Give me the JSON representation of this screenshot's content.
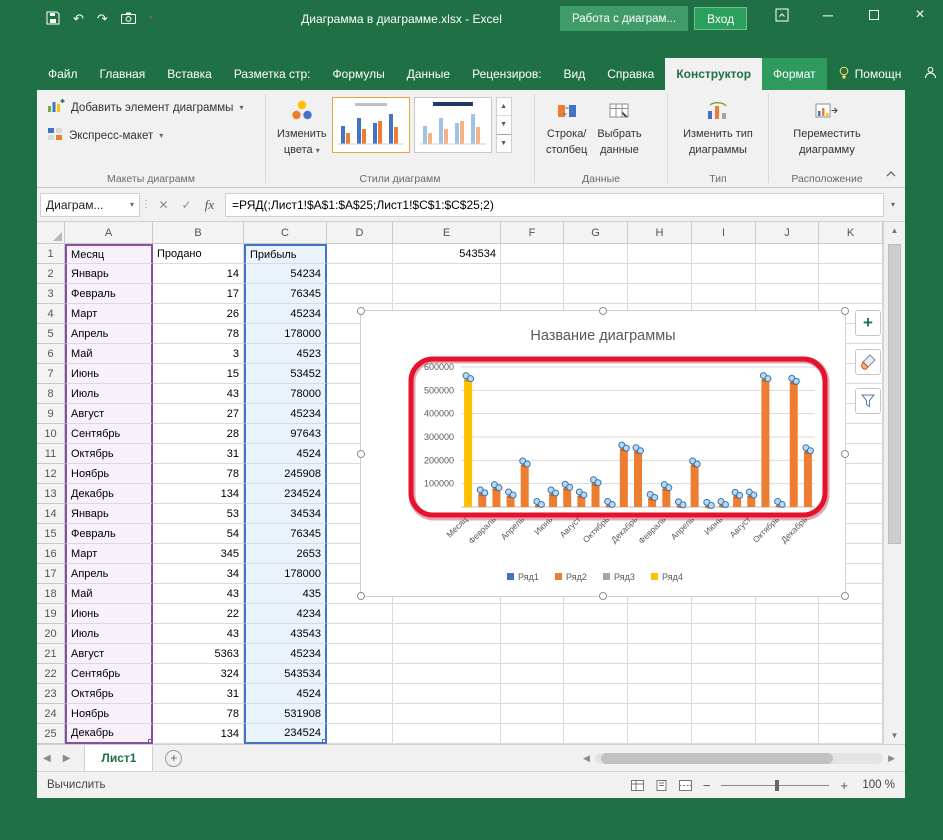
{
  "window": {
    "title": "Диаграмма в диаграмме.xlsx  -  Excel",
    "context_group": "Работа с диаграм...",
    "sign_in": "Вход"
  },
  "tabs": {
    "items": [
      {
        "id": "file",
        "label": "Файл"
      },
      {
        "id": "home",
        "label": "Главная"
      },
      {
        "id": "insert",
        "label": "Вставка"
      },
      {
        "id": "page-layout",
        "label": "Разметка стр:"
      },
      {
        "id": "formulas",
        "label": "Формулы"
      },
      {
        "id": "data",
        "label": "Данные"
      },
      {
        "id": "review",
        "label": "Рецензиров:"
      },
      {
        "id": "view",
        "label": "Вид"
      },
      {
        "id": "help",
        "label": "Справка"
      },
      {
        "id": "design",
        "label": "Конструктор"
      },
      {
        "id": "format",
        "label": "Формат"
      }
    ],
    "active_id": "design",
    "assistant": "Помощн",
    "share": "Поделиться"
  },
  "ribbon": {
    "add_element": "Добавить элемент диаграммы",
    "quick_layout": "Экспресс-макет",
    "change_colors": [
      "Изменить",
      "цвета"
    ],
    "row_col": [
      "Строка/",
      "столбец"
    ],
    "select_data": [
      "Выбрать",
      "данные"
    ],
    "change_type": [
      "Изменить тип",
      "диаграммы"
    ],
    "move_chart": [
      "Переместить",
      "диаграмму"
    ],
    "groups": {
      "layouts": "Макеты диаграмм",
      "styles": "Стили диаграмм",
      "data": "Данные",
      "type": "Тип",
      "location": "Расположение"
    }
  },
  "formula_bar": {
    "name_box": "Диаграм...",
    "fx": "fx",
    "formula": "=РЯД(;Лист1!$A$1:$A$25;Лист1!$C$1:$C$25;2)"
  },
  "grid": {
    "col_headers": [
      "A",
      "B",
      "C",
      "D",
      "E",
      "F",
      "G",
      "H",
      "I",
      "J",
      "K"
    ],
    "rows": [
      {
        "n": "1",
        "A": "Месяц",
        "B": "Продано",
        "C": "Прибыль",
        "E": "543534"
      },
      {
        "n": "2",
        "A": "Январь",
        "B": "14",
        "C": "54234"
      },
      {
        "n": "3",
        "A": "Февраль",
        "B": "17",
        "C": "76345"
      },
      {
        "n": "4",
        "A": "Март",
        "B": "26",
        "C": "45234"
      },
      {
        "n": "5",
        "A": "Апрель",
        "B": "78",
        "C": "178000"
      },
      {
        "n": "6",
        "A": "Май",
        "B": "3",
        "C": "4523"
      },
      {
        "n": "7",
        "A": "Июнь",
        "B": "15",
        "C": "53452"
      },
      {
        "n": "8",
        "A": "Июль",
        "B": "43",
        "C": "78000"
      },
      {
        "n": "9",
        "A": "Август",
        "B": "27",
        "C": "45234"
      },
      {
        "n": "10",
        "A": "Сентябрь",
        "B": "28",
        "C": "97643"
      },
      {
        "n": "11",
        "A": "Октябрь",
        "B": "31",
        "C": "4524"
      },
      {
        "n": "12",
        "A": "Ноябрь",
        "B": "78",
        "C": "245908"
      },
      {
        "n": "13",
        "A": "Декабрь",
        "B": "134",
        "C": "234524"
      },
      {
        "n": "14",
        "A": "Январь",
        "B": "53",
        "C": "34534"
      },
      {
        "n": "15",
        "A": "Февраль",
        "B": "54",
        "C": "76345"
      },
      {
        "n": "16",
        "A": "Март",
        "B": "345",
        "C": "2653"
      },
      {
        "n": "17",
        "A": "Апрель",
        "B": "34",
        "C": "178000"
      },
      {
        "n": "18",
        "A": "Май",
        "B": "43",
        "C": "435"
      },
      {
        "n": "19",
        "A": "Июнь",
        "B": "22",
        "C": "4234"
      },
      {
        "n": "20",
        "A": "Июль",
        "B": "43",
        "C": "43543"
      },
      {
        "n": "21",
        "A": "Август",
        "B": "5363",
        "C": "45234"
      },
      {
        "n": "22",
        "A": "Сентябрь",
        "B": "324",
        "C": "543534"
      },
      {
        "n": "23",
        "A": "Октябрь",
        "B": "31",
        "C": "4524"
      },
      {
        "n": "24",
        "A": "Ноябрь",
        "B": "78",
        "C": "531908"
      },
      {
        "n": "25",
        "A": "Декабрь",
        "B": "134",
        "C": "234524"
      }
    ]
  },
  "chart_data": {
    "type": "bar",
    "title": "Название диаграммы",
    "categories": [
      "Месяц",
      "Январь",
      "Февраль",
      "Март",
      "Апрель",
      "Май",
      "Июнь",
      "Июль",
      "Август",
      "Сентябрь",
      "Октябрь",
      "Ноябрь",
      "Декабрь",
      "Январь",
      "Февраль",
      "Март",
      "Апрель",
      "Май",
      "Июнь",
      "Июль",
      "Август",
      "Сентябрь",
      "Октябрь",
      "Ноябрь",
      "Декабрь"
    ],
    "x_tick_step": 2,
    "ylim": [
      0,
      600000
    ],
    "yticks": [
      100000,
      200000,
      300000,
      400000,
      500000,
      600000
    ],
    "grid": true,
    "legend_position": "bottom",
    "series": [
      {
        "name": "Ряд1",
        "color": "#4472C4",
        "type": "marker-cluster"
      },
      {
        "name": "Ряд2",
        "color": "#ED7D31",
        "type": "column",
        "values": [
          0,
          54234,
          76345,
          45234,
          178000,
          4523,
          53452,
          78000,
          45234,
          97643,
          4524,
          245908,
          234524,
          34534,
          76345,
          2653,
          178000,
          435,
          4234,
          43543,
          45234,
          543534,
          4524,
          531908,
          234524
        ]
      },
      {
        "name": "Ряд3",
        "color": "#A5A5A5",
        "type": "column",
        "values": []
      },
      {
        "name": "Ряд4",
        "color": "#FFC000",
        "type": "column",
        "values": [
          543534,
          0,
          0,
          0,
          0,
          0,
          0,
          0,
          0,
          0,
          0,
          0,
          0,
          0,
          0,
          0,
          0,
          0,
          0,
          0,
          0,
          0,
          0,
          0,
          0
        ]
      }
    ],
    "annotation": {
      "shape": "rounded-rectangle",
      "color": "#E8112D",
      "around": "plot-area"
    }
  },
  "sheet_tabs": {
    "active": "Лист1"
  },
  "status_bar": {
    "left": "Вычислить",
    "zoom": "100 %"
  }
}
